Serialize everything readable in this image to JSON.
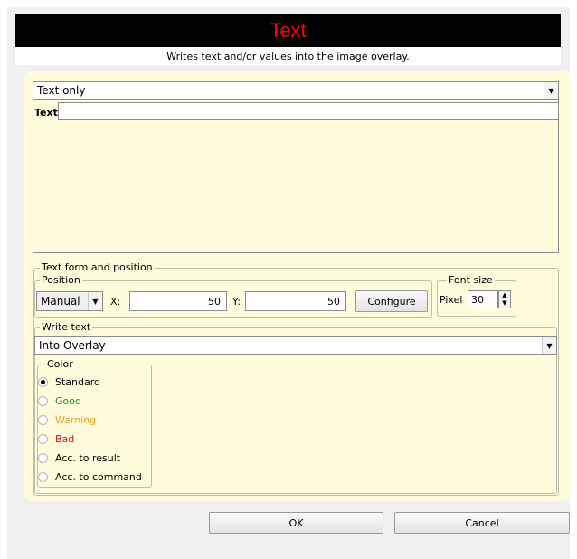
{
  "dialog": {
    "title": "Text",
    "subtitle": "Writes text and/or values into the image overlay."
  },
  "mode_select": {
    "value": "Text only"
  },
  "text_field": {
    "label": "Text",
    "value": ""
  },
  "text_form": {
    "group_title": "Text form and position",
    "position": {
      "group_title": "Position",
      "mode_value": "Manual",
      "x_label": "X:",
      "x_value": "50",
      "y_label": "Y:",
      "y_value": "50",
      "configure_label": "Configure"
    },
    "font_size": {
      "group_title": "Font size",
      "unit_label": "Pixel",
      "value": "30"
    }
  },
  "write_text": {
    "group_title": "Write text",
    "target_value": "Into Overlay",
    "color": {
      "group_title": "Color",
      "options": [
        {
          "label": "Standard",
          "color": "#000000",
          "checked": true
        },
        {
          "label": "Good",
          "color": "#1e8f1e",
          "checked": false
        },
        {
          "label": "Warning",
          "color": "#f0a020",
          "checked": false
        },
        {
          "label": "Bad",
          "color": "#e01010",
          "checked": false
        },
        {
          "label": "Acc. to result",
          "color": "#000000",
          "checked": false
        },
        {
          "label": "Acc. to command",
          "color": "#000000",
          "checked": false
        }
      ]
    }
  },
  "footer": {
    "ok_label": "OK",
    "cancel_label": "Cancel"
  },
  "colors": {
    "title_bg": "#000000",
    "title_fg": "#ff0000",
    "panel_bg": "#fefcdc"
  }
}
